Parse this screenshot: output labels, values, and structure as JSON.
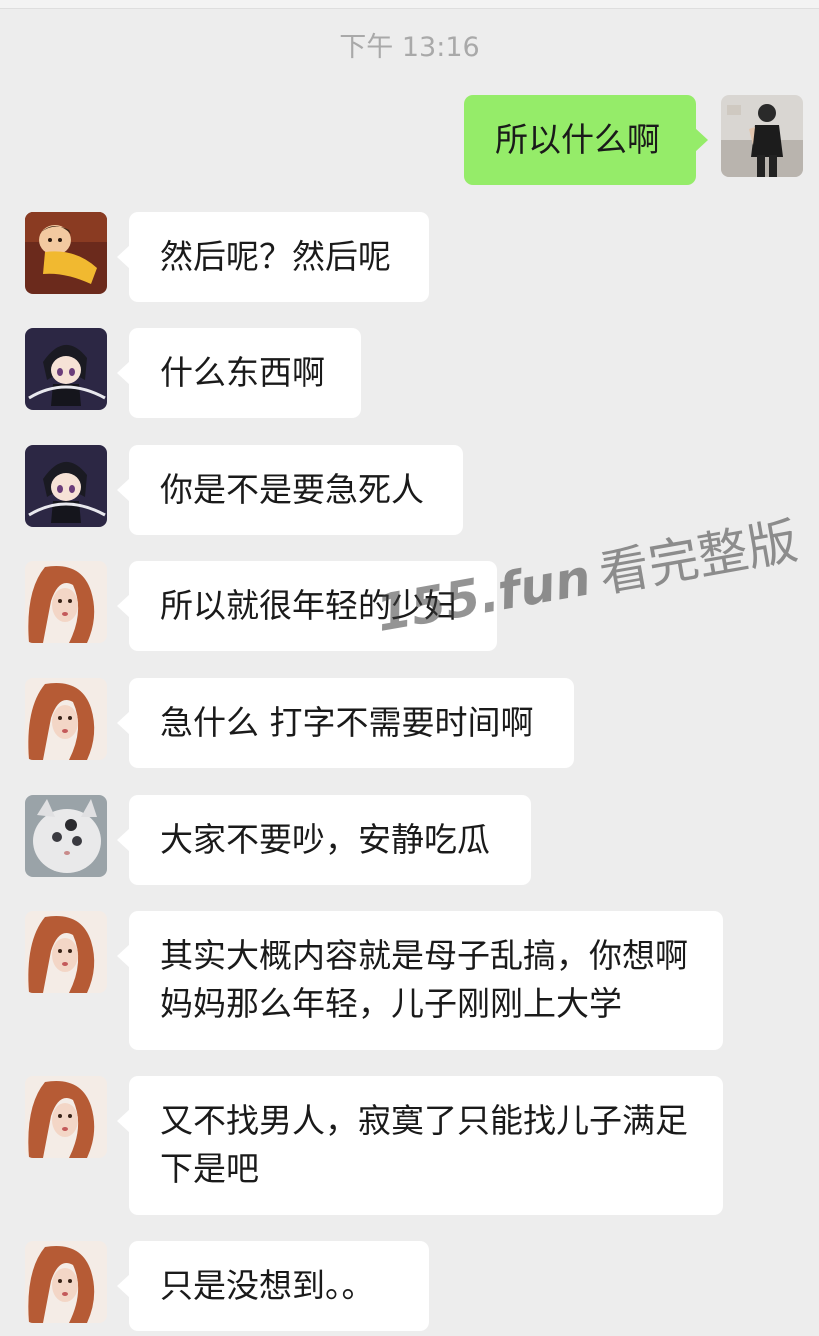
{
  "timestamp": "下午 13:16",
  "messages": [
    {
      "side": "out",
      "avatar": "photo-avatar",
      "text": "所以什么啊"
    },
    {
      "side": "in",
      "avatar": "cartoon-girl-avatar",
      "text": "然后呢？然后呢"
    },
    {
      "side": "in",
      "avatar": "anime-avatar",
      "text": "什么东西啊"
    },
    {
      "side": "in",
      "avatar": "anime-avatar",
      "text": "你是不是要急死人"
    },
    {
      "side": "in",
      "avatar": "redhair-avatar",
      "text": "所以就很年轻的少妇"
    },
    {
      "side": "in",
      "avatar": "redhair-avatar",
      "text": "急什么 打字不需要时间啊"
    },
    {
      "side": "in",
      "avatar": "cat-avatar",
      "text": "大家不要吵，安静吃瓜"
    },
    {
      "side": "in",
      "avatar": "redhair-avatar",
      "text": "其实大概内容就是母子乱搞，你想啊 妈妈那么年轻，儿子刚刚上大学"
    },
    {
      "side": "in",
      "avatar": "redhair-avatar",
      "text": "又不找男人，寂寞了只能找儿子满足下是吧"
    },
    {
      "side": "in",
      "avatar": "redhair-avatar",
      "text": "只是没想到。。"
    }
  ],
  "watermark": {
    "domain": "155.fun",
    "text": "看完整版"
  },
  "colors": {
    "background": "#ededed",
    "incoming_bubble": "#ffffff",
    "outgoing_bubble": "#95ec69",
    "timestamp": "#a9a9a9"
  }
}
